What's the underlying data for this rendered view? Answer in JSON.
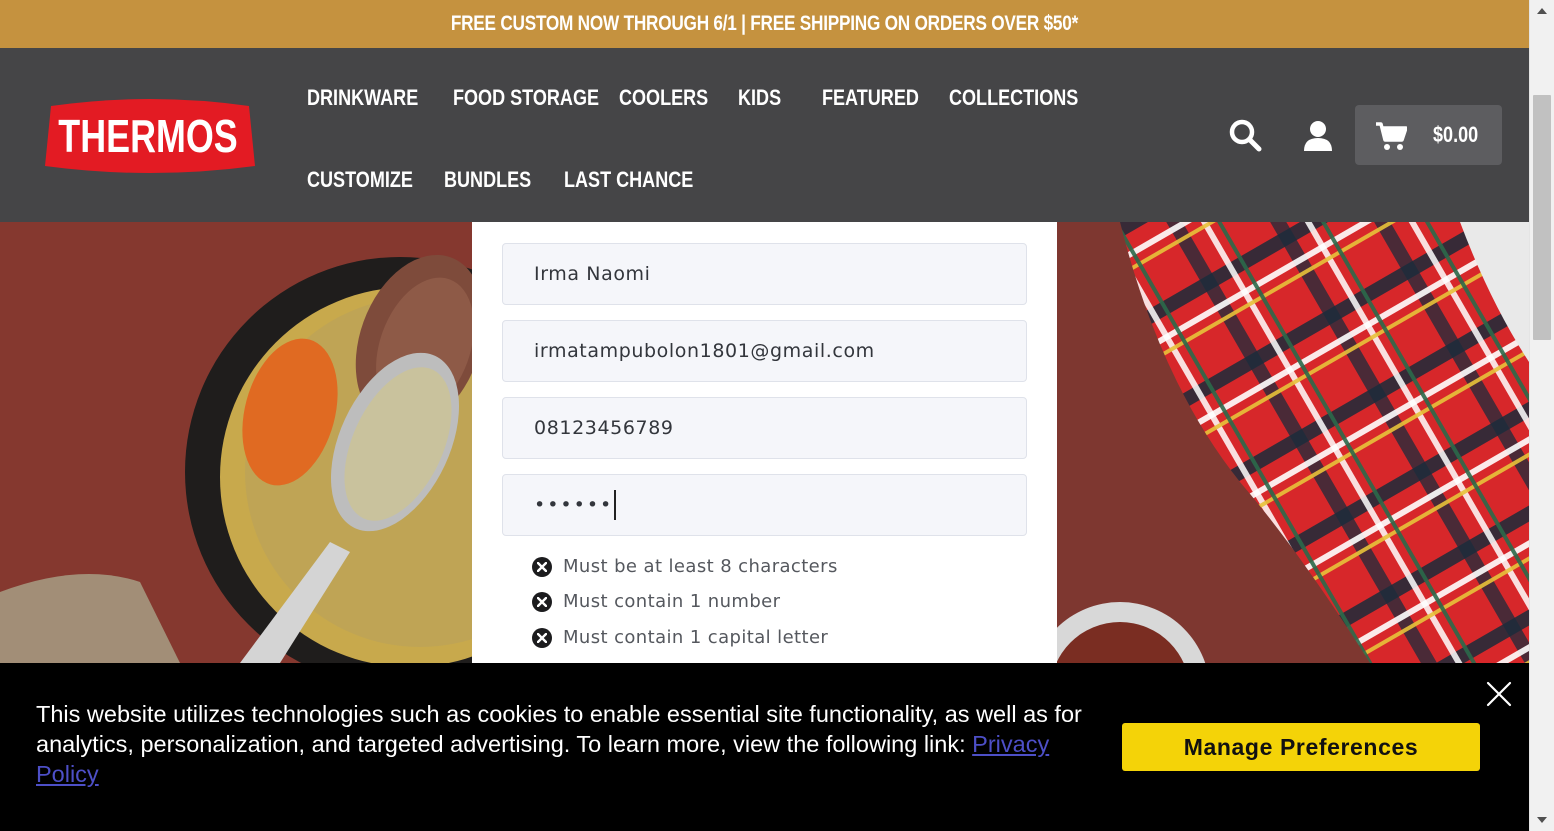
{
  "promo": {
    "text": "FREE CUSTOM NOW THROUGH 6/1 | FREE SHIPPING ON ORDERS OVER $50*"
  },
  "header": {
    "logo_text": "THERMOS",
    "nav_row1": [
      "DRINKWARE",
      "FOOD STORAGE",
      "COOLERS",
      "KIDS",
      "FEATURED",
      "COLLECTIONS"
    ],
    "nav_row2": [
      "CUSTOMIZE",
      "BUNDLES",
      "LAST CHANCE"
    ],
    "cart_total": "$0.00",
    "icons": {
      "search": "search-icon",
      "account": "user-icon",
      "cart": "cart-icon"
    }
  },
  "form": {
    "name_value": "Irma Naomi",
    "email_value": "irmatampubolon1801@gmail.com",
    "phone_value": "08123456789",
    "password_masked": "••••••",
    "rules": [
      "Must be at least 8 characters",
      "Must contain 1 number",
      "Must contain 1 capital letter"
    ]
  },
  "cookie": {
    "text": "This website utilizes technologies such as cookies to enable essential site functionality, as well as for analytics, personalization, and targeted advertising. To learn more, view the following link: ",
    "link_label": "Privacy Policy",
    "button_label": "Manage Preferences"
  },
  "colors": {
    "promo_bg": "#c5923f",
    "header_bg": "#454547",
    "logo_red": "#e31b23",
    "cookie_bg": "#000000",
    "button_yellow": "#f4d308",
    "link": "#4d4fc7"
  }
}
